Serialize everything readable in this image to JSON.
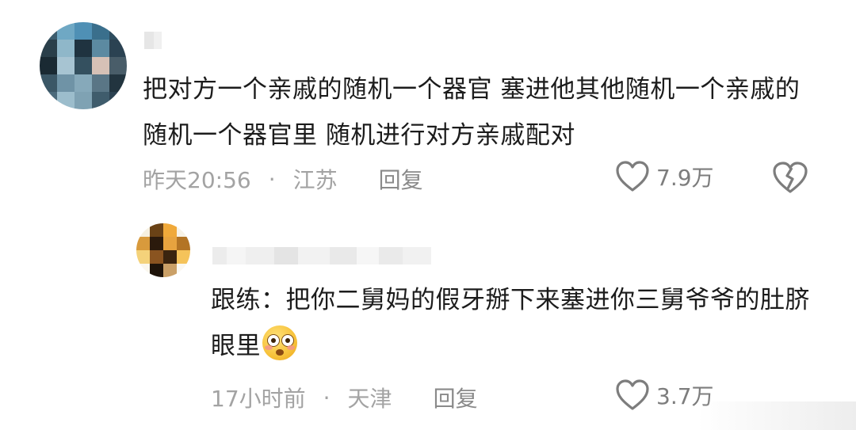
{
  "comments": [
    {
      "text": "把对方一个亲戚的随机一个器官  塞进他其他随机一个亲戚的随机一个器官里   随机进行对方亲戚配对",
      "time": "昨天20:56",
      "location": "江苏",
      "reply_label": "回复",
      "likes": "7.9万",
      "icons": {
        "like": "heart-icon",
        "dislike": "broken-heart-icon"
      }
    },
    {
      "text": "跟练：把你二舅妈的假牙掰下来塞进你三舅爷爷的肚脐眼里",
      "emoji": "flushed-face",
      "time": "17小时前",
      "location": "天津",
      "reply_label": "回复",
      "likes": "3.7万",
      "icons": {
        "like": "heart-icon"
      }
    }
  ],
  "separator": "·",
  "colors": {
    "text": "#1c1c1c",
    "meta": "#a3a3a3",
    "icon": "#7d7d7d"
  }
}
